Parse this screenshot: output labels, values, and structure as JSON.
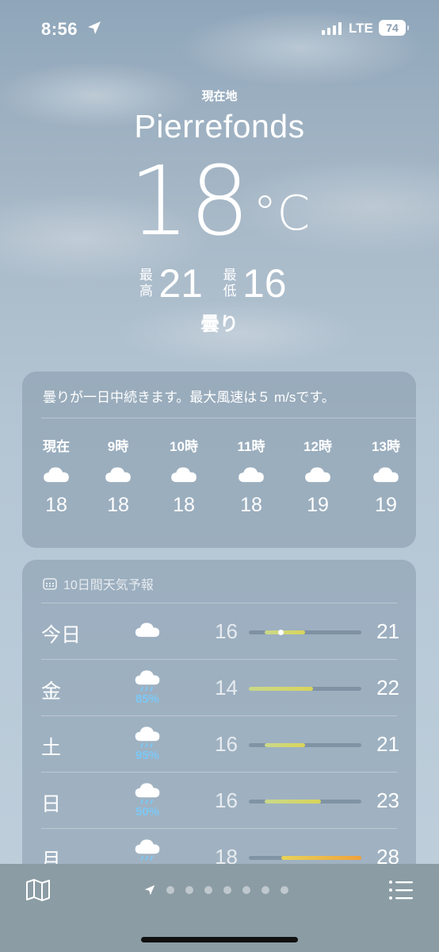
{
  "status_bar": {
    "time": "8:56",
    "network": "LTE",
    "battery": "74"
  },
  "header": {
    "location_label": "現在地",
    "city": "Pierrefonds",
    "temperature": "18",
    "unit": "°C",
    "high_label": "最高",
    "high": "21",
    "low_label": "最低",
    "low": "16",
    "condition": "曇り"
  },
  "hourly": {
    "summary": "曇りが一日中続きます。最大風速は５ m/sです。",
    "hours": [
      {
        "label": "現在",
        "icon": "cloud-icon",
        "temp": "18"
      },
      {
        "label": "9時",
        "icon": "cloud-icon",
        "temp": "18"
      },
      {
        "label": "10時",
        "icon": "cloud-icon",
        "temp": "18"
      },
      {
        "label": "11時",
        "icon": "cloud-icon",
        "temp": "18"
      },
      {
        "label": "12時",
        "icon": "cloud-icon",
        "temp": "19"
      },
      {
        "label": "13時",
        "icon": "cloud-icon",
        "temp": "19"
      }
    ]
  },
  "forecast": {
    "title": "10日間天気予報",
    "days": [
      {
        "day": "今日",
        "icon": "cloud-icon",
        "precip": "",
        "low": "16",
        "high": "21"
      },
      {
        "day": "金",
        "icon": "rain-cloud-icon",
        "precip": "85%",
        "low": "14",
        "high": "22"
      },
      {
        "day": "土",
        "icon": "rain-cloud-icon",
        "precip": "95%",
        "low": "16",
        "high": "21"
      },
      {
        "day": "日",
        "icon": "rain-cloud-icon",
        "precip": "50%",
        "low": "16",
        "high": "23"
      },
      {
        "day": "月",
        "icon": "rain-cloud-icon",
        "precip": "",
        "low": "18",
        "high": "28"
      }
    ]
  },
  "colors": {
    "precip": "#7cc8f6",
    "bar_cool": "#c9d98a",
    "bar_warm": "#f0a23a"
  }
}
